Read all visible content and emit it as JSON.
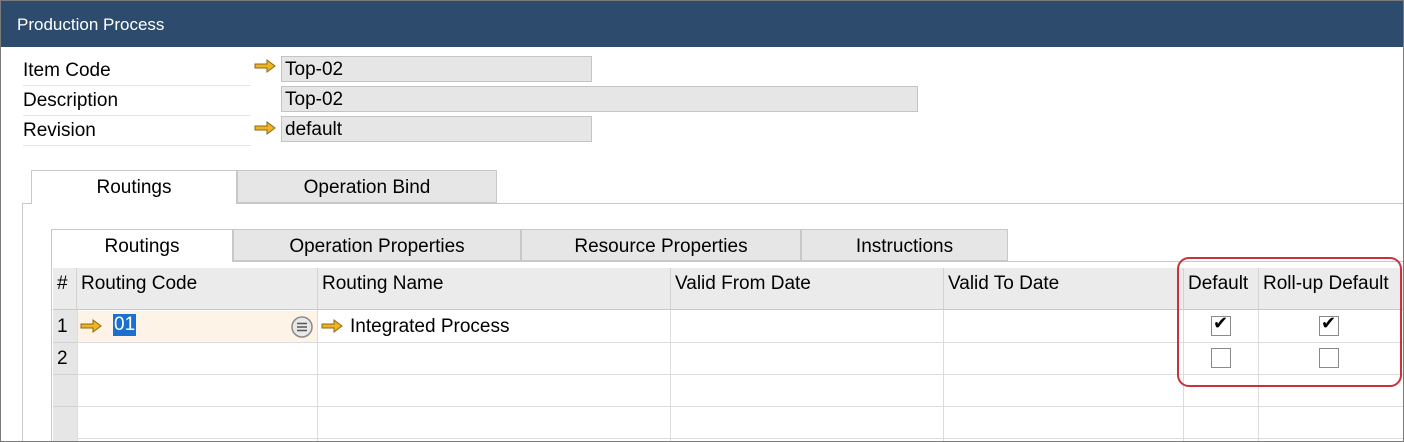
{
  "window": {
    "title": "Production Process"
  },
  "header_fields": {
    "item_code": {
      "label": "Item Code",
      "value": "Top-02"
    },
    "description": {
      "label": "Description",
      "value": "Top-02"
    },
    "revision": {
      "label": "Revision",
      "value": "default"
    }
  },
  "outer_tabs": [
    {
      "label": "Routings",
      "active": true
    },
    {
      "label": "Operation Bind",
      "active": false
    }
  ],
  "inner_tabs": [
    {
      "label": "Routings",
      "active": true
    },
    {
      "label": "Operation Properties",
      "active": false
    },
    {
      "label": "Resource Properties",
      "active": false
    },
    {
      "label": "Instructions",
      "active": false
    }
  ],
  "grid": {
    "columns": [
      "#",
      "Routing Code",
      "Routing Name",
      "Valid From Date",
      "Valid To Date",
      "Default",
      "Roll-up Default"
    ],
    "rows": [
      {
        "num": "1",
        "routing_code": "01",
        "routing_name": "Integrated Process",
        "valid_from": "",
        "valid_to": "",
        "default": true,
        "rollup_default": true
      },
      {
        "num": "2",
        "routing_code": "",
        "routing_name": "",
        "valid_from": "",
        "valid_to": "",
        "default": false,
        "rollup_default": false
      }
    ]
  },
  "colors": {
    "titlebar": "#2d4b6c",
    "link_arrow": "#f0b323",
    "highlight": "#c9323a",
    "selection": "#1a6fd0"
  },
  "icons": {
    "link_arrow": "link-arrow-icon",
    "choose_from_list": "choose-list-icon"
  }
}
